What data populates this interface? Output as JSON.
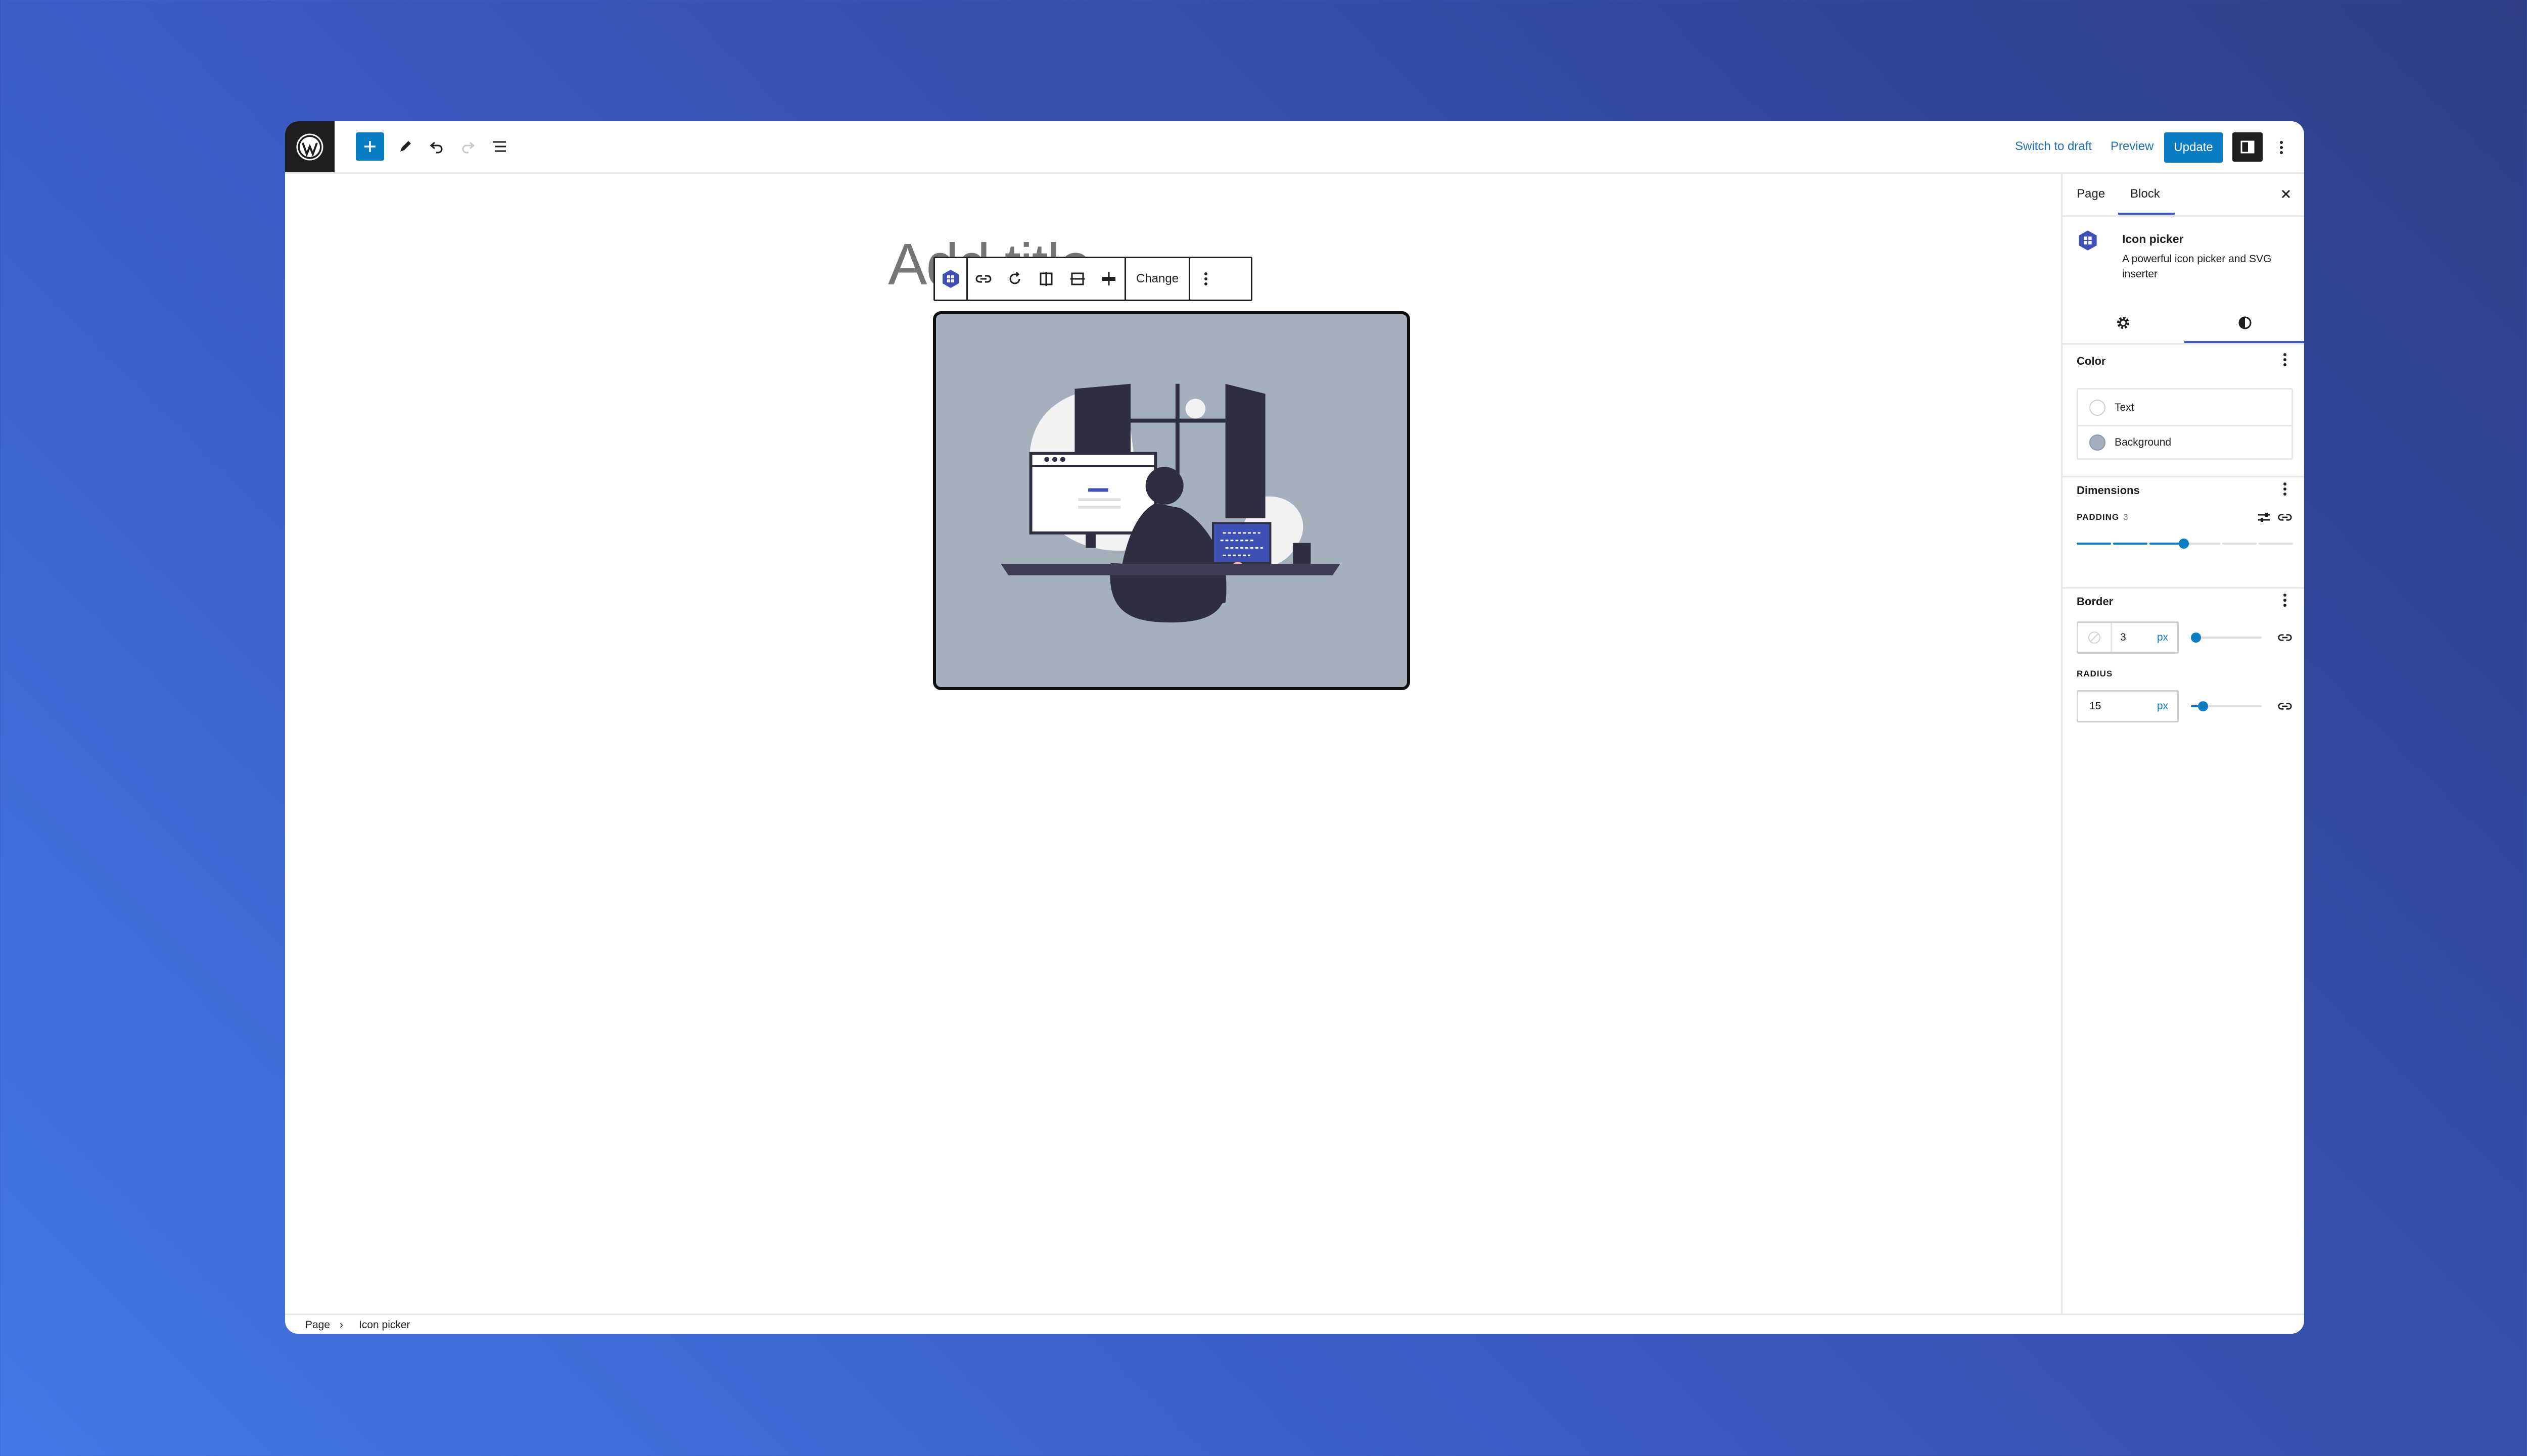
{
  "topbar": {
    "switch_to_draft": "Switch to draft",
    "preview": "Preview",
    "update": "Update",
    "icons": [
      "wordpress-icon",
      "plus-icon",
      "pencil-icon",
      "undo-icon",
      "redo-icon",
      "list-view-icon",
      "sidebar-toggle-icon",
      "more-vertical-icon"
    ]
  },
  "editor": {
    "title_placeholder": "Add title",
    "toolbar": {
      "change_label": "Change"
    }
  },
  "sidebar": {
    "tabs": {
      "page": "Page",
      "block": "Block"
    },
    "block": {
      "name": "Icon picker",
      "description": "A powerful icon picker and SVG inserter"
    },
    "color": {
      "title": "Color",
      "text": "Text",
      "background": "Background",
      "background_swatch": "#a5b0bd"
    },
    "dimensions": {
      "title": "Dimensions",
      "padding_label": "PADDING",
      "padding_value": "3",
      "padding_step": 3,
      "padding_steps_total": 6
    },
    "border": {
      "title": "Border",
      "width_value": "3",
      "width_unit": "px",
      "radius_label": "RADIUS",
      "radius_value": "15",
      "radius_unit": "px"
    }
  },
  "footer": {
    "crumb_page": "Page",
    "crumb_separator": "›",
    "crumb_block": "Icon picker"
  },
  "colors": {
    "accent": "#0a7cc4",
    "tab_underline": "#3858e9",
    "dark": "#1e1e1e"
  }
}
